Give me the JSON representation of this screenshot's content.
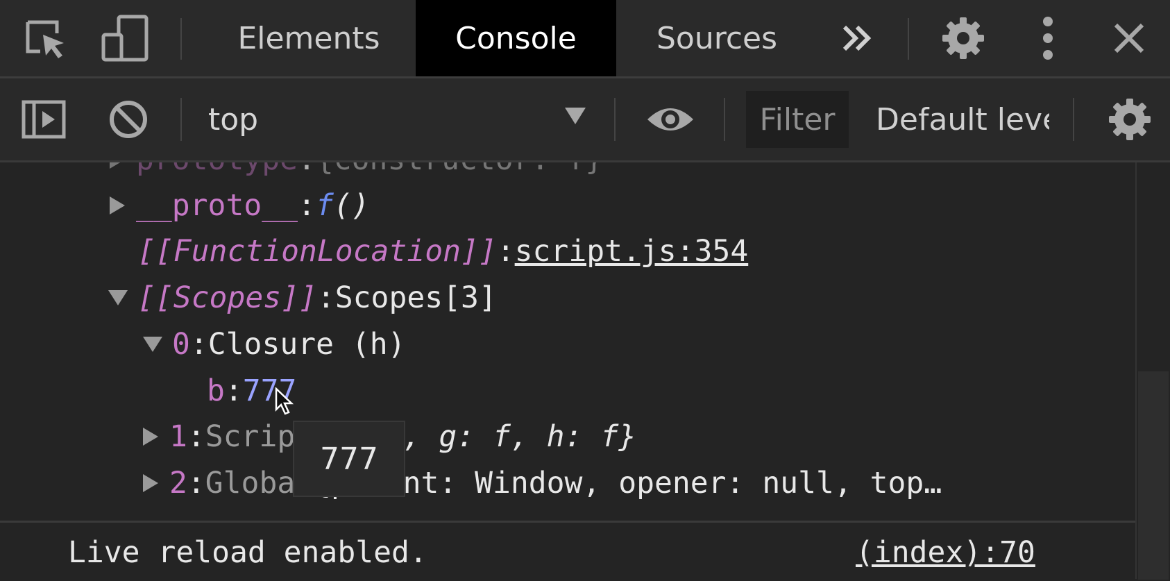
{
  "tabbar": {
    "tabs": [
      "Elements",
      "Console",
      "Sources"
    ],
    "active_tab": "Console",
    "more_label": "»"
  },
  "toolbar": {
    "context": "top",
    "filter_placeholder": "Filter",
    "levels_label": "Default levels"
  },
  "console": {
    "lines": {
      "prototype": {
        "key": "prototype",
        "value": "{constructor: f}"
      },
      "proto": {
        "key": "__proto__",
        "sep": ": ",
        "value_fn": "f",
        "value_rest": " ()"
      },
      "function_location": {
        "key": "[[FunctionLocation]]",
        "sep": ": ",
        "value": "script.js:354"
      },
      "scopes": {
        "key": "[[Scopes]]",
        "sep": ": ",
        "value": "Scopes[3]"
      },
      "scope0": {
        "index": "0",
        "sep": ": ",
        "value": "Closure (h)"
      },
      "b": {
        "key": "b",
        "sep": ": ",
        "value": "777"
      },
      "scope1": {
        "index": "1",
        "sep": ": ",
        "type": "Script",
        "value": "{g: f, g: f, h: f}"
      },
      "scope2": {
        "index": "2",
        "sep": ": ",
        "type": "Global",
        "value": "{parent: Window, opener: null, top…"
      }
    },
    "tooltip": "777"
  },
  "footer": {
    "message": "Live reload enabled.",
    "source": "(index):70"
  }
}
